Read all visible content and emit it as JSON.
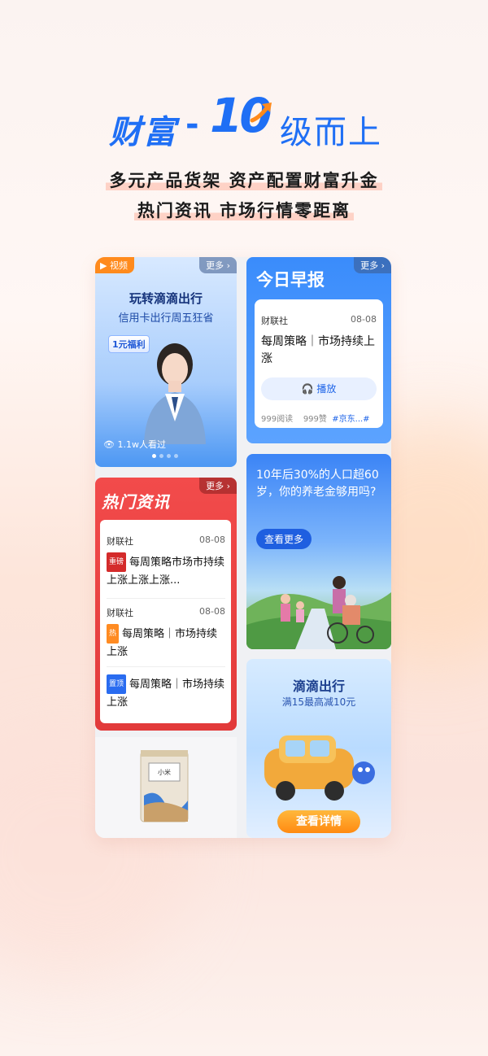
{
  "hero": {
    "brand": "财富",
    "dash": "-",
    "level": "10",
    "suffix": "级而上",
    "tagline1": "多元产品货架 资产配置财富升金",
    "tagline2": "热门资讯 市场行情零距离"
  },
  "video_card": {
    "tag": "视频",
    "more": "更多",
    "title": "玩转滴滴出行",
    "subtitle": "信用卡出行周五狂省",
    "badge": "1元福利",
    "views": "1.1w人看过"
  },
  "today_report": {
    "title": "今日早报",
    "more": "更多",
    "source": "财联社",
    "date": "08-08",
    "headline": "每周策略｜市场持续上涨",
    "play_label": "播放",
    "reads": "999阅读",
    "likes": "999赞",
    "tags": "#京东...#"
  },
  "hot_news": {
    "title": "热门资讯",
    "more": "更多",
    "items": [
      {
        "source": "财联社",
        "date": "08-08",
        "badge": "重磅",
        "text": "每周策略市场市持续上涨上涨上涨..."
      },
      {
        "source": "财联社",
        "date": "08-08",
        "badge": "热",
        "text": "每周策略｜市场持续上涨"
      },
      {
        "badge": "置顶",
        "text": "每周策略｜市场持续上涨"
      }
    ]
  },
  "pension_card": {
    "question": "10年后30%的人口超60岁，你的养老金够用吗?",
    "button": "查看更多"
  },
  "didi_card": {
    "title": "滴滴出行",
    "subtitle": "满15最高减10元",
    "button": "查看详情"
  },
  "product_card": {
    "label": "小米"
  }
}
